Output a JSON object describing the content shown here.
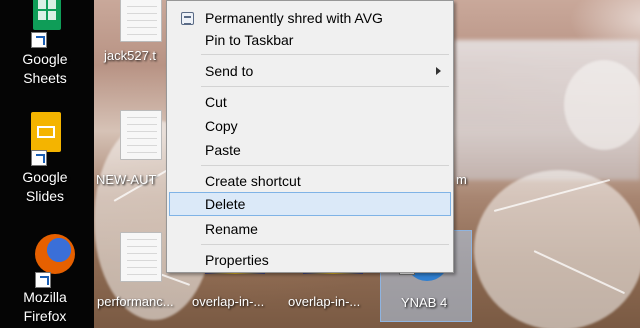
{
  "desktop": {
    "left_icons": [
      {
        "label_line1": "Google",
        "label_line2": "Sheets",
        "icon": "google-sheets-icon",
        "color": "#0f9d58"
      },
      {
        "label_line1": "Google",
        "label_line2": "Slides",
        "icon": "google-slides-icon",
        "color": "#f4b400"
      },
      {
        "label_line1": "Mozilla",
        "label_line2": "Firefox",
        "icon": "firefox-icon",
        "color": "#e66000"
      }
    ],
    "files": [
      {
        "label": "jack527.t"
      },
      {
        "label": "NEW-AUT"
      },
      {
        "label": "performanc..."
      },
      {
        "label": "overlap-in-..."
      },
      {
        "label": "overlap-in-..."
      },
      {
        "label": "YNAB 4"
      },
      {
        "label": "m"
      }
    ]
  },
  "context_menu": {
    "items": [
      {
        "label": "Permanently shred with AVG",
        "icon": "avg-shred-icon"
      },
      {
        "label": "Pin to Taskbar"
      },
      {
        "label": "Send to",
        "submenu": true
      },
      {
        "label": "Cut"
      },
      {
        "label": "Copy"
      },
      {
        "label": "Paste"
      },
      {
        "label": "Create shortcut"
      },
      {
        "label": "Delete",
        "highlighted": true
      },
      {
        "label": "Rename"
      },
      {
        "label": "Properties"
      }
    ],
    "highlight_color": "#dbe9f8"
  }
}
